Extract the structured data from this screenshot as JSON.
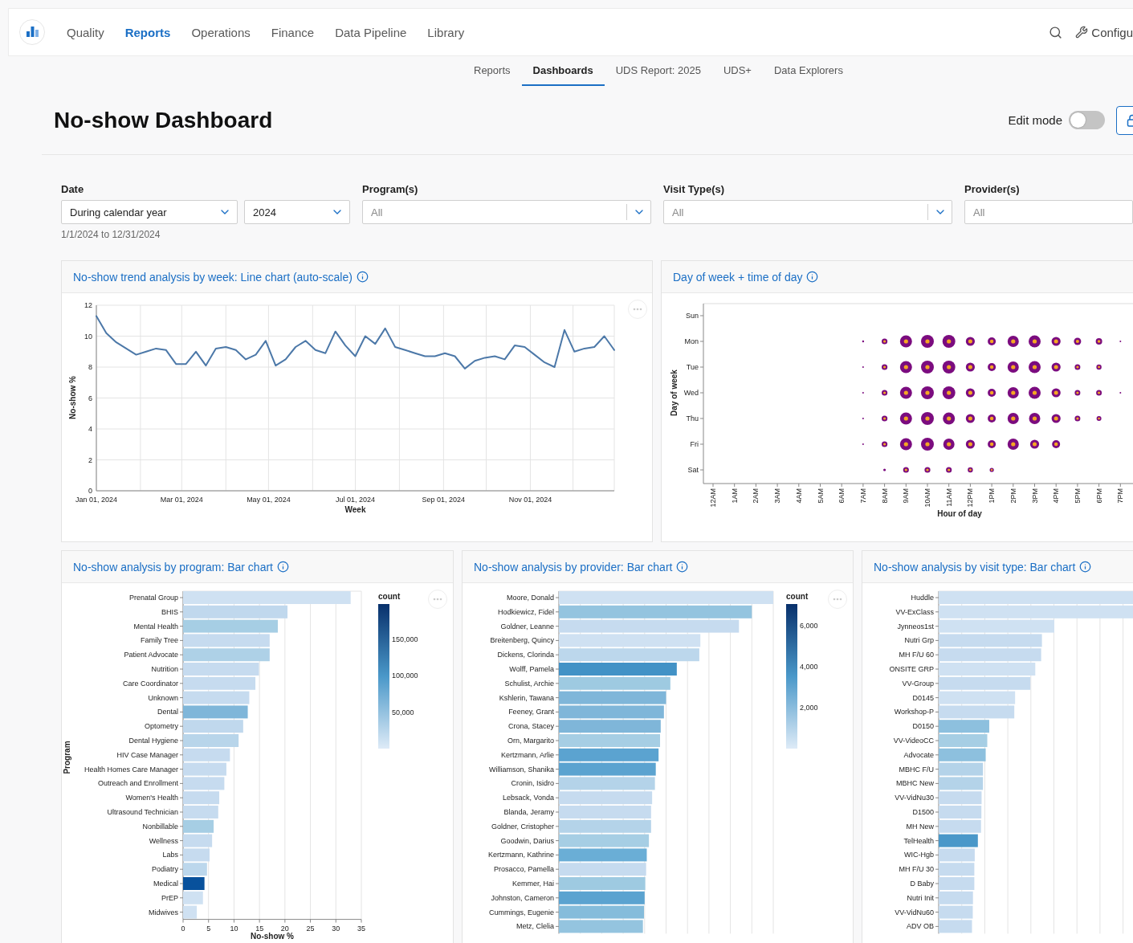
{
  "nav": {
    "items": [
      {
        "label": "Quality",
        "selected": false
      },
      {
        "label": "Reports",
        "selected": true
      },
      {
        "label": "Operations",
        "selected": false
      },
      {
        "label": "Finance",
        "selected": false
      },
      {
        "label": "Data Pipeline",
        "selected": false
      },
      {
        "label": "Library",
        "selected": false
      }
    ],
    "config_label": "Configu"
  },
  "subnav": [
    {
      "label": "Reports",
      "selected": false
    },
    {
      "label": "Dashboards",
      "selected": true
    },
    {
      "label": "UDS Report: 2025",
      "selected": false
    },
    {
      "label": "UDS+",
      "selected": false
    },
    {
      "label": "Data Explorers",
      "selected": false
    }
  ],
  "page": {
    "title": "No-show Dashboard",
    "edit_mode": {
      "label": "Edit mode",
      "on": false
    }
  },
  "filters": {
    "date": {
      "label": "Date",
      "period": "During calendar year",
      "year": "2024",
      "range": "1/1/2024 to 12/31/2024"
    },
    "others": [
      {
        "label": "Program(s)",
        "value": "All"
      },
      {
        "label": "Visit Type(s)",
        "value": "All"
      },
      {
        "label": "Provider(s)",
        "value": "All"
      }
    ]
  },
  "trend_panel": {
    "title": "No-show trend analysis by week: Line chart (auto-scale)",
    "chart_data": {
      "type": "line",
      "xlabel": "Week",
      "ylabel": "No-show %",
      "x": [
        "2024-01-01",
        "2024-01-08",
        "2024-01-15",
        "2024-01-22",
        "2024-01-29",
        "2024-02-05",
        "2024-02-12",
        "2024-02-19",
        "2024-02-26",
        "2024-03-04",
        "2024-03-11",
        "2024-03-18",
        "2024-03-25",
        "2024-04-01",
        "2024-04-08",
        "2024-04-15",
        "2024-04-22",
        "2024-04-29",
        "2024-05-06",
        "2024-05-13",
        "2024-05-20",
        "2024-05-27",
        "2024-06-03",
        "2024-06-10",
        "2024-06-17",
        "2024-06-24",
        "2024-07-01",
        "2024-07-08",
        "2024-07-15",
        "2024-07-22",
        "2024-07-29",
        "2024-08-05",
        "2024-08-12",
        "2024-08-19",
        "2024-08-26",
        "2024-09-02",
        "2024-09-09",
        "2024-09-16",
        "2024-09-23",
        "2024-09-30",
        "2024-10-07",
        "2024-10-14",
        "2024-10-21",
        "2024-10-28",
        "2024-11-04",
        "2024-11-11",
        "2024-11-18",
        "2024-11-25",
        "2024-12-02",
        "2024-12-09",
        "2024-12-16",
        "2024-12-23",
        "2024-12-30"
      ],
      "grid": true,
      "xlim": [
        "2024-01-01",
        "2024-12-30"
      ],
      "series": [
        {
          "color": "#4c78a8",
          "values": [
            11.3,
            10.2,
            9.6,
            9.2,
            8.8,
            9.0,
            9.2,
            9.1,
            8.2,
            8.2,
            9.0,
            8.1,
            9.2,
            9.3,
            9.1,
            8.5,
            8.8,
            9.7,
            8.1,
            8.5,
            9.3,
            9.7,
            9.1,
            8.9,
            10.3,
            9.4,
            8.7,
            10.0,
            9.5,
            10.5,
            9.3,
            9.1,
            8.9,
            8.7,
            8.7,
            8.9,
            8.7,
            7.9,
            8.4,
            8.6,
            8.7,
            8.5,
            9.4,
            9.3,
            8.8,
            8.3,
            8.0,
            10.4,
            9.0,
            9.2,
            9.3,
            10.0,
            9.1
          ]
        }
      ],
      "ylim": [
        0,
        12
      ],
      "yticks": [
        0,
        2,
        4,
        6,
        8,
        10,
        12
      ],
      "xticks": [
        {
          "value": "2024-01-01",
          "label": "Jan 01, 2024"
        },
        {
          "value": "2024-03-01",
          "label": "Mar 01, 2024"
        },
        {
          "value": "2024-05-01",
          "label": "May 01, 2024"
        },
        {
          "value": "2024-07-01",
          "label": "Jul 01, 2024"
        },
        {
          "value": "2024-09-01",
          "label": "Sep 01, 2024"
        },
        {
          "value": "2024-11-01",
          "label": "Nov 01, 2024"
        }
      ]
    }
  },
  "time_panel": {
    "title": "Day of week + time of day",
    "xlabel": "Hour of day",
    "ylabel": "Day of week",
    "days": [
      "Sun",
      "Mon",
      "Tue",
      "Wed",
      "Thu",
      "Fri",
      "Sat"
    ],
    "hours": [
      "12AM",
      "1AM",
      "2AM",
      "3AM",
      "4AM",
      "5AM",
      "6AM",
      "7AM",
      "8AM",
      "9AM",
      "10AM",
      "11AM",
      "12PM",
      "1PM",
      "2PM",
      "3PM",
      "4PM",
      "5PM",
      "6PM",
      "7PM"
    ]
  },
  "program_panel": {
    "title": "No-show analysis by program: Bar chart",
    "legend": {
      "title": "count",
      "ticks": [
        "150,000",
        "100,000",
        "50,000"
      ]
    },
    "chart_data": {
      "type": "bar",
      "orientation": "horizontal",
      "xlabel": "No-show %",
      "ylabel": "Program",
      "categories": [
        "Prenatal Group",
        "BHIS",
        "Mental Health",
        "Family Tree",
        "Patient Advocate",
        "Nutrition",
        "Care Coordinator",
        "Unknown",
        "Dental",
        "Optometry",
        "Dental Hygiene",
        "HIV Case Manager",
        "Health Homes Care Manager",
        "Outreach and Enrollment",
        "Women's Health",
        "Ultrasound Technician",
        "Nonbillable",
        "Wellness",
        "Labs",
        "Podiatry",
        "Medical",
        "PrEP",
        "Midwives"
      ],
      "grid": true,
      "series": [
        {
          "values": [
            32.9,
            20.5,
            18.6,
            17.0,
            17.0,
            14.9,
            14.2,
            13.0,
            12.7,
            11.8,
            10.9,
            9.2,
            8.5,
            8.1,
            7.1,
            6.9,
            6.0,
            5.7,
            5.2,
            4.7,
            4.2,
            3.9,
            2.7
          ],
          "colors": [
            "#cfe1f2",
            "#c0d8ed",
            "#a6cee4",
            "#c6dbef",
            "#aed1e7",
            "#c6dbef",
            "#c6dbef",
            "#c6dbef",
            "#7fb6d9",
            "#c0d8ed",
            "#b8d5ea",
            "#c6dbef",
            "#c6dbef",
            "#c6dbef",
            "#c6dbef",
            "#c6dbef",
            "#a6cee4",
            "#c6dbef",
            "#c6dbef",
            "#bcd7ec",
            "#08519c",
            "#cfe1f2",
            "#cfe1f2"
          ]
        }
      ],
      "xlim": [
        0,
        35
      ],
      "xticks": [
        0,
        5,
        10,
        15,
        20,
        25,
        30,
        35
      ]
    }
  },
  "provider_panel": {
    "title": "No-show analysis by provider: Bar chart",
    "legend": {
      "title": "count",
      "ticks": [
        "6,000",
        "4,000",
        "2,000"
      ]
    },
    "bars": [
      {
        "label": "Moore, Donald",
        "color": "#cfe1f2"
      },
      {
        "label": "Hodkiewicz, Fidel",
        "color": "#94c4df"
      },
      {
        "label": "Goldner, Leanne",
        "color": "#c6dbef"
      },
      {
        "label": "Breitenberg, Quincy",
        "color": "#cfe1f2"
      },
      {
        "label": "Dickens, Clorinda",
        "color": "#bcd7ec"
      },
      {
        "label": "Wolff, Pamela",
        "color": "#4292c6"
      },
      {
        "label": "Schulist, Archie",
        "color": "#9ecae1"
      },
      {
        "label": "Kshlerin, Tawana",
        "color": "#7fb6d9"
      },
      {
        "label": "Feeney, Grant",
        "color": "#7fb6d9"
      },
      {
        "label": "Crona, Stacey",
        "color": "#7fb6d9"
      },
      {
        "label": "Orn, Margarito",
        "color": "#a6cee4"
      },
      {
        "label": "Kertzmann, Arlie",
        "color": "#5ba3d0"
      },
      {
        "label": "Williamson, Shanika",
        "color": "#5ba3d0"
      },
      {
        "label": "Cronin, Isidro",
        "color": "#b4d3e9"
      },
      {
        "label": "Lebsack, Vonda",
        "color": "#c6dbef"
      },
      {
        "label": "Blanda, Jeramy",
        "color": "#c6dbef"
      },
      {
        "label": "Goldner, Cristopher",
        "color": "#b4d3e9"
      },
      {
        "label": "Goodwin, Darius",
        "color": "#a6cee4"
      },
      {
        "label": "Kertzmann, Kathrine",
        "color": "#6aaed6"
      },
      {
        "label": "Prosacco, Pamella",
        "color": "#c6dbef"
      },
      {
        "label": "Kemmer, Hai",
        "color": "#9ecae1"
      },
      {
        "label": "Johnston, Cameron",
        "color": "#5ba3d0"
      },
      {
        "label": "Cummings, Eugenie",
        "color": "#85bcdb"
      },
      {
        "label": "Metz, Clelia",
        "color": "#94c4df"
      }
    ]
  },
  "visit_panel": {
    "title": "No-show analysis by visit type: Bar chart",
    "bars": [
      {
        "label": "Huddle",
        "color": "#cfe1f2"
      },
      {
        "label": "VV-ExClass",
        "color": "#cfe1f2"
      },
      {
        "label": "Jynneos1st",
        "color": "#cfe1f2"
      },
      {
        "label": "Nutri Grp",
        "color": "#c6dbef"
      },
      {
        "label": "MH F/U 60",
        "color": "#c6dbef"
      },
      {
        "label": "ONSITE GRP",
        "color": "#cfe1f2"
      },
      {
        "label": "VV-Group",
        "color": "#c6dbef"
      },
      {
        "label": "D0145",
        "color": "#cfe1f2"
      },
      {
        "label": "Workshop-P",
        "color": "#c6dbef"
      },
      {
        "label": "D0150",
        "color": "#8dc0de"
      },
      {
        "label": "VV-VideoCC",
        "color": "#a6cee4"
      },
      {
        "label": "Advocate",
        "color": "#8dc0de"
      },
      {
        "label": "MBHC F/U",
        "color": "#b4d3e9"
      },
      {
        "label": "MBHC New",
        "color": "#b4d3e9"
      },
      {
        "label": "VV-VidNu30",
        "color": "#c6dbef"
      },
      {
        "label": "D1500",
        "color": "#c6dbef"
      },
      {
        "label": "MH New",
        "color": "#c6dbef"
      },
      {
        "label": "TelHealth",
        "color": "#4a98c9"
      },
      {
        "label": "WIC-Hgb",
        "color": "#c6dbef"
      },
      {
        "label": "MH F/U 30",
        "color": "#c6dbef"
      },
      {
        "label": "D Baby",
        "color": "#c6dbef"
      },
      {
        "label": "Nutri Init",
        "color": "#c6dbef"
      },
      {
        "label": "VV-VidNu60",
        "color": "#c6dbef"
      },
      {
        "label": "ADV OB",
        "color": "#c6dbef"
      }
    ]
  }
}
